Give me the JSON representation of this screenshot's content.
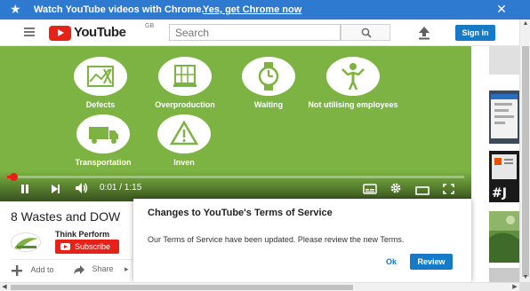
{
  "promo": {
    "message": "Watch YouTube videos with Chrome.",
    "cta": "Yes, get Chrome now",
    "trailing": "."
  },
  "masthead": {
    "logo_text": "YouTube",
    "country_code": "GB",
    "search_placeholder": "Search",
    "signin_label": "Sign in"
  },
  "video": {
    "items": [
      {
        "label": "Defects",
        "icon": "chart-icon"
      },
      {
        "label": "Overproduction",
        "icon": "pallet-icon"
      },
      {
        "label": "Waiting",
        "icon": "watch-icon"
      },
      {
        "label": "Not utilising employees",
        "icon": "person-icon"
      },
      {
        "label": "Transportation",
        "icon": "truck-icon"
      },
      {
        "label": "Inven",
        "icon": "warning-icon"
      }
    ],
    "current_time": "0:01",
    "duration": "1:15",
    "time_display": "0:01 / 1:15",
    "progress_fraction": 0.013,
    "accent_color": "#e62117",
    "background_color": "#7cb342"
  },
  "info": {
    "title": "8 Wastes and DOW",
    "channel": "Think Perform",
    "subscribe_label": "Subscribe",
    "add_to_label": "Add to",
    "share_label": "Share"
  },
  "dialog": {
    "title": "Changes to YouTube's Terms of Service",
    "message": "Our Terms of Service have been updated. Please review the new Terms.",
    "ok_label": "Ok",
    "review_label": "Review"
  },
  "colors": {
    "brand_blue": "#167ac6",
    "promo_blue": "#2e7ad1",
    "youtube_red": "#e62117"
  }
}
